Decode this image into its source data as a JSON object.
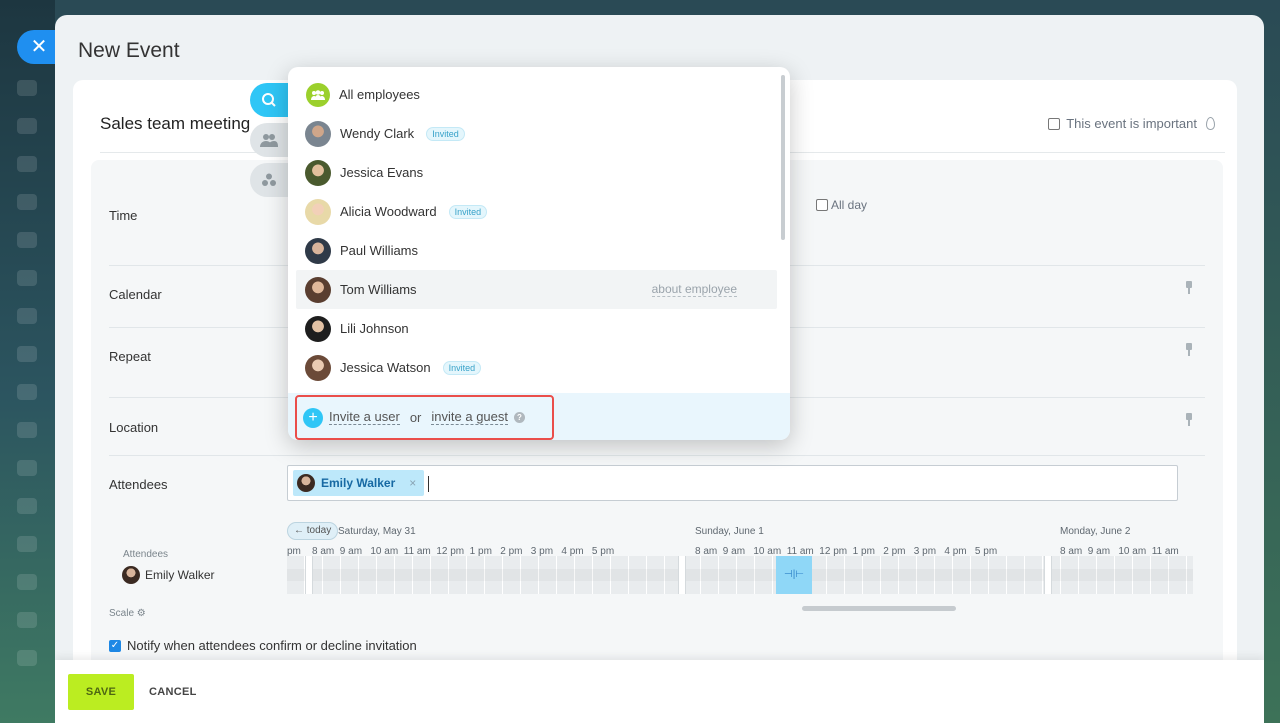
{
  "window": {
    "title": "New Event"
  },
  "event": {
    "name": "Sales team meeting",
    "important_label": "This event is important"
  },
  "form": {
    "time_label": "Time",
    "all_day_label": "All day",
    "calendar_label": "Calendar",
    "repeat_label": "Repeat",
    "location_label": "Location",
    "attendees_label": "Attendees"
  },
  "attendee_chip": {
    "name": "Emily Walker",
    "remove": "×"
  },
  "dropdown": {
    "items": [
      {
        "name": "All employees",
        "badge": ""
      },
      {
        "name": "Wendy Clark",
        "badge": "Invited"
      },
      {
        "name": "Jessica Evans",
        "badge": ""
      },
      {
        "name": "Alicia Woodward",
        "badge": "Invited"
      },
      {
        "name": "Paul Williams",
        "badge": ""
      },
      {
        "name": "Tom Williams",
        "badge": "",
        "link": "about employee"
      },
      {
        "name": "Lili Johnson",
        "badge": ""
      },
      {
        "name": "Jessica Watson",
        "badge": "Invited"
      }
    ],
    "invite_user": "Invite a user",
    "or": "or",
    "invite_guest": "invite a guest"
  },
  "schedule": {
    "today": "← today",
    "dates": [
      "Saturday, May 31",
      "Sunday, June 1",
      "Monday, June 2"
    ],
    "hours_1": "pm    8 am  9 am   10 am  11 am  12 pm  1 pm   2 pm   3 pm   4 pm   5 pm",
    "hours_2": "8 am  9 am   10 am  11 am  12 pm  1 pm   2 pm   3 pm   4 pm   5 pm",
    "hours_3": "8 am  9 am   10 am  11 am",
    "attendees_heading": "Attendees",
    "attendee": "Emily Walker",
    "slot_handle": "⊣|⊢",
    "scale_label": "Scale"
  },
  "notify_label": "Notify when attendees confirm or decline invitation",
  "footer": {
    "save": "SAVE",
    "cancel": "CANCEL"
  },
  "icons": {
    "close": "close-icon",
    "flame": "flame-icon",
    "pin": "pin-icon",
    "plus": "plus-icon",
    "help": "help-icon"
  },
  "colors": {
    "accent": "#2fc6f6",
    "save": "#bbed21",
    "highlight": "#ea4e4b",
    "badge": "#38a2c9"
  }
}
